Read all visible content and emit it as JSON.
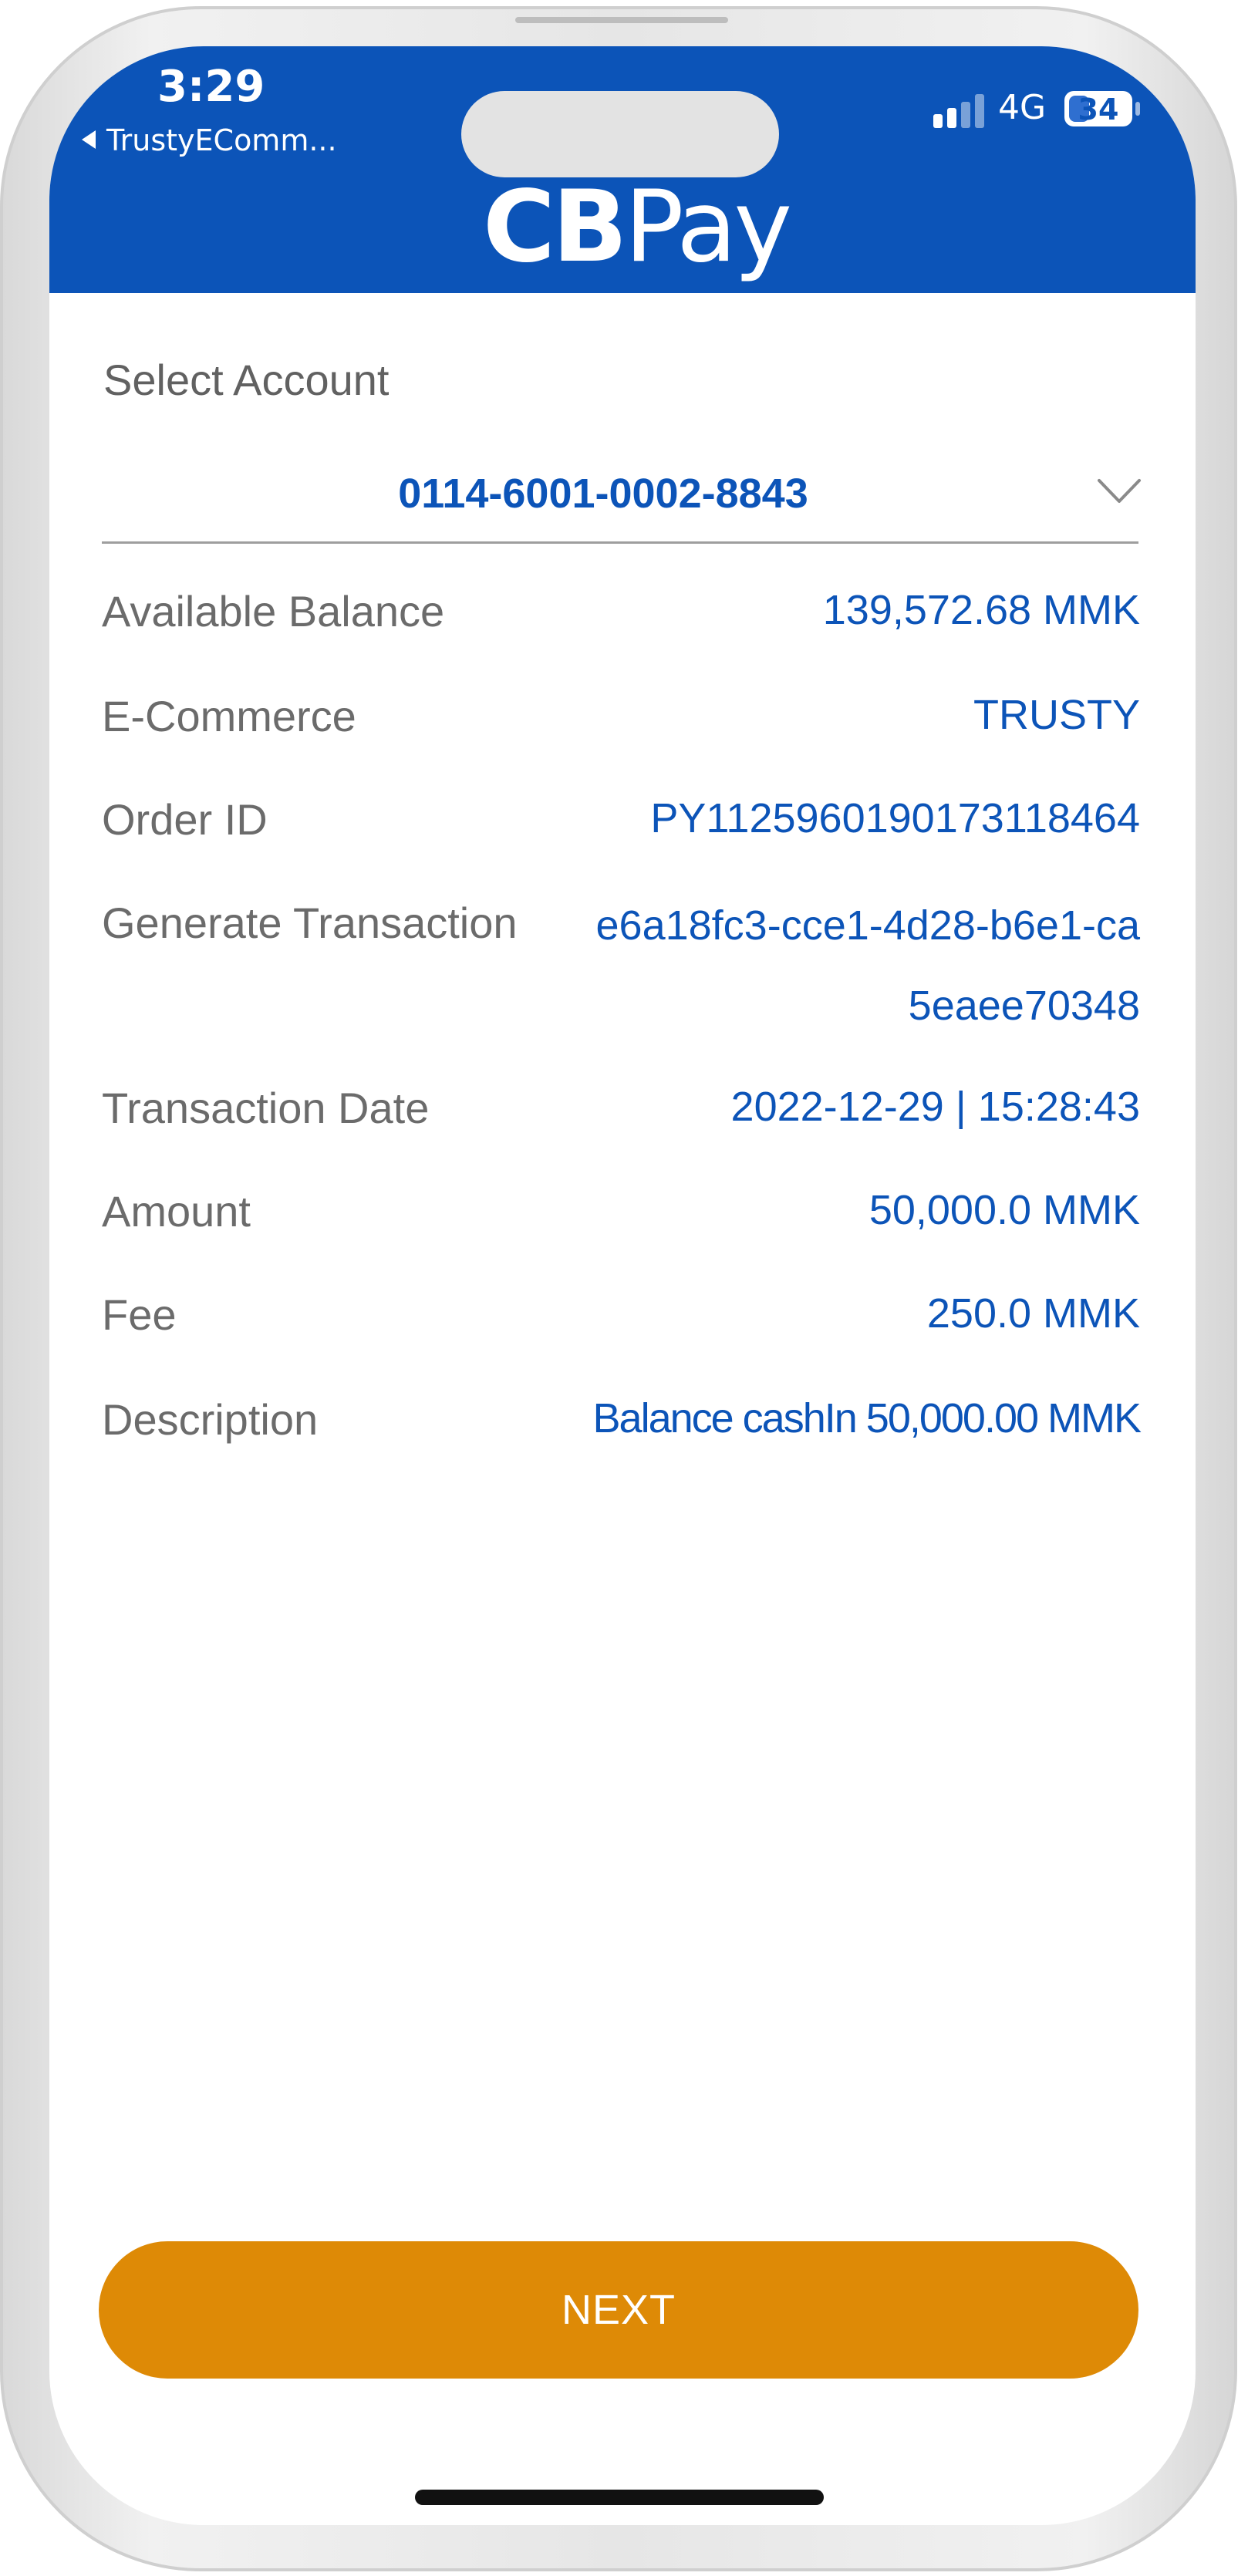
{
  "status_bar": {
    "time": "3:29",
    "back_label": "TrustyEComm...",
    "network": "4G",
    "battery_percent": "34",
    "battery_level": 0.34,
    "signal_bars_active": 2,
    "signal_bars_total": 4
  },
  "header": {
    "logo_cb": "CB",
    "logo_pay": "Pay",
    "background_color": "#0c54b8"
  },
  "account": {
    "label": "Select Account",
    "selected": "0114-6001-0002-8843"
  },
  "details": [
    {
      "label": "Available Balance",
      "value": "139,572.68 MMK"
    },
    {
      "label": "E-Commerce",
      "value": "TRUSTY"
    },
    {
      "label": "Order ID",
      "value": "PY1125960190173118464"
    },
    {
      "label": "Generate Transaction",
      "value": "e6a18fc3-cce1-4d28-b6e1-ca5eaee70348"
    },
    {
      "label": "Transaction Date",
      "value": "2022-12-29 | 15:28:43"
    },
    {
      "label": "Amount",
      "value": "50,000.0 MMK"
    },
    {
      "label": "Fee",
      "value": "250.0 MMK"
    },
    {
      "label": "Description",
      "value": "Balance cashIn 50,000.00 MMK"
    }
  ],
  "actions": {
    "next_label": "NEXT",
    "next_color": "#de8a06"
  },
  "colors": {
    "accent_blue": "#0c54b8",
    "label_gray": "#6b6b6b"
  }
}
